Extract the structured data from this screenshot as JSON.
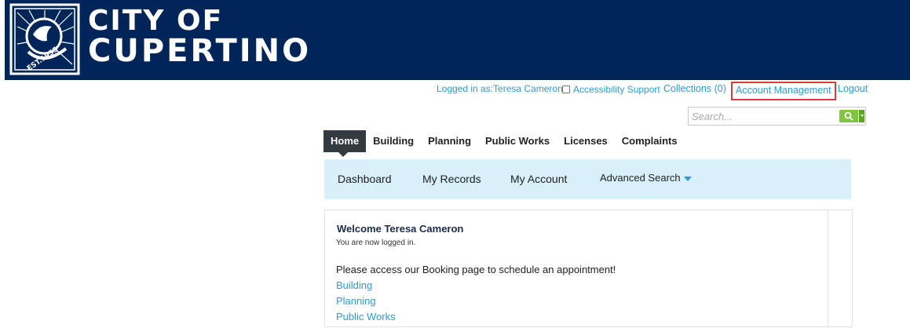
{
  "header": {
    "brand_line1": "CITY OF",
    "brand_line2": "CUPERTINO",
    "seal_text": "EST. 1955",
    "colors": {
      "banner": "#002559",
      "accent": "#2e9bd6"
    }
  },
  "toplinks": {
    "logged_in": "Logged in as:Teresa Cameron",
    "accessibility": "Accessibility Support",
    "collections": "Collections (0)",
    "account_management": "Account Management",
    "logout": "Logout"
  },
  "search": {
    "placeholder": "Search...",
    "icon": "search-icon"
  },
  "tabs": [
    {
      "label": "Home",
      "active": true
    },
    {
      "label": "Building"
    },
    {
      "label": "Planning"
    },
    {
      "label": "Public Works"
    },
    {
      "label": "Licenses"
    },
    {
      "label": "Complaints"
    }
  ],
  "subnav": {
    "dashboard": "Dashboard",
    "my_records": "My Records",
    "my_account": "My Account",
    "advanced_search": "Advanced Search"
  },
  "content": {
    "welcome": "Welcome Teresa Cameron",
    "logged_msg": "You are now logged in.",
    "booking_msg": "Please access our Booking page to schedule an appointment!",
    "links": [
      "Building",
      "Planning",
      "Public Works"
    ]
  }
}
